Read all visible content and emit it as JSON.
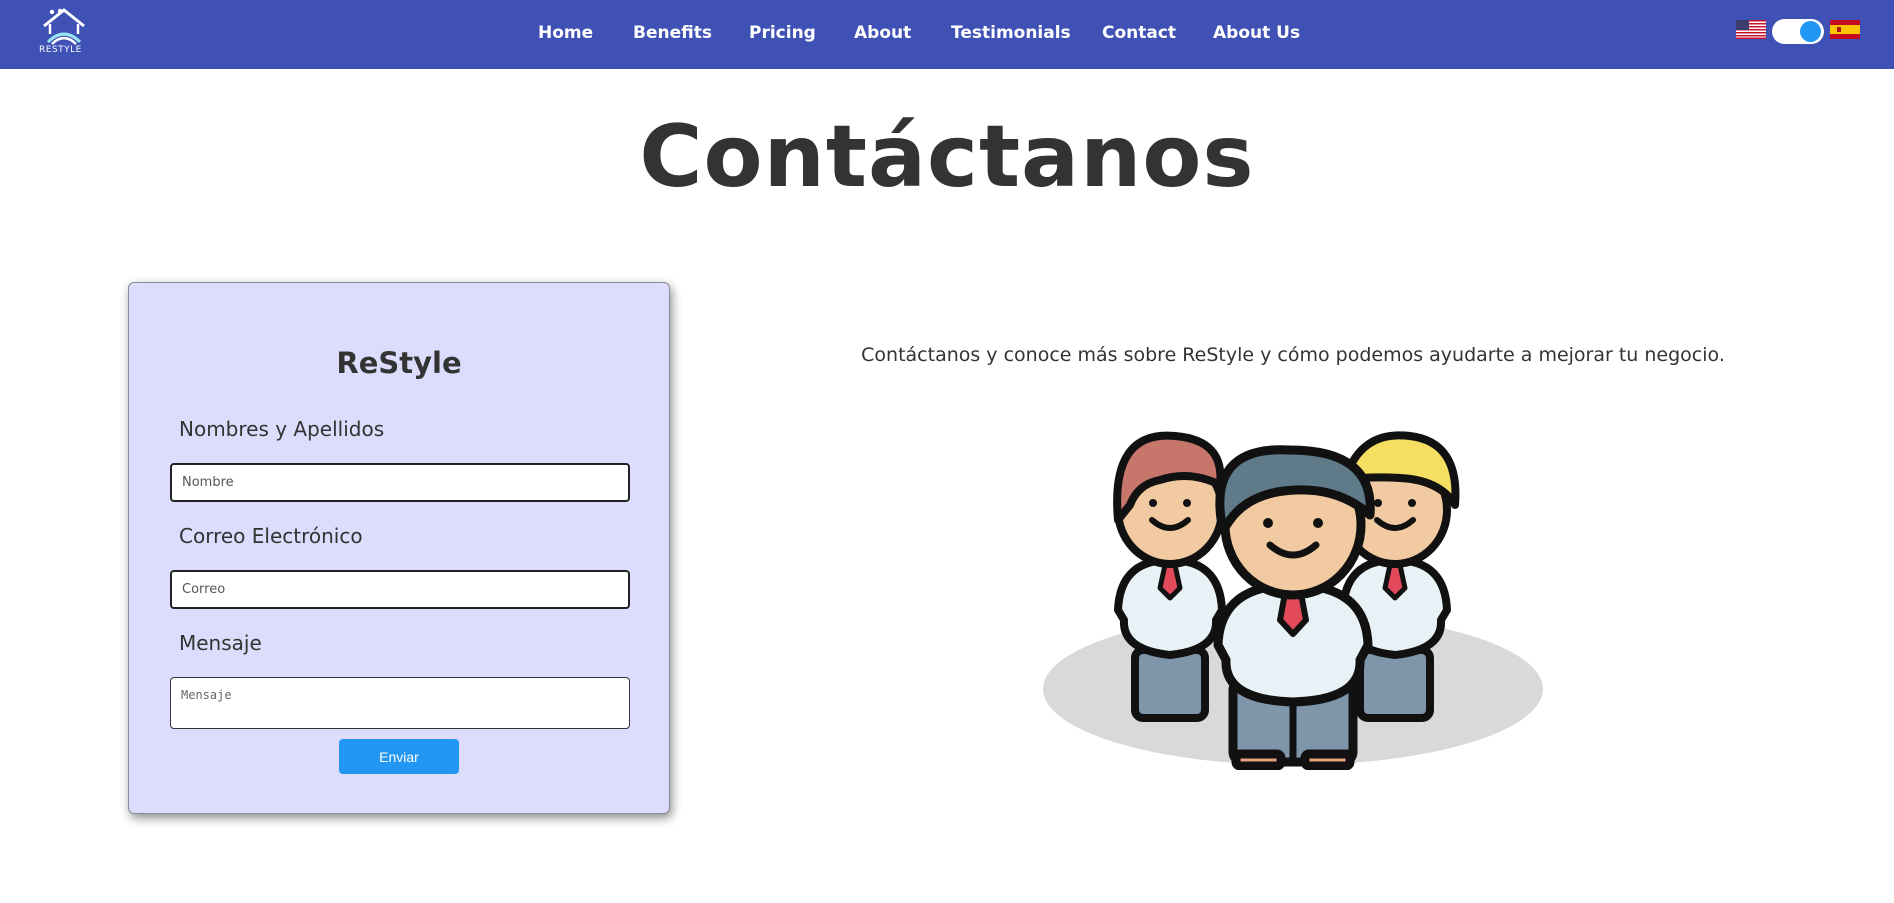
{
  "brand": {
    "logo_text": "RESTYLE"
  },
  "nav": {
    "links": [
      "Home",
      "Benefits",
      "Pricing",
      "About",
      "Testimonials",
      "Contact",
      "About Us"
    ]
  },
  "language": {
    "left_flag": "us-flag-icon",
    "right_flag": "spain-flag-icon",
    "toggle_state": "on"
  },
  "page": {
    "title": "Contáctanos"
  },
  "form": {
    "title": "ReStyle",
    "name_label": "Nombres y Apellidos",
    "name_placeholder": "Nombre",
    "email_label": "Correo Electrónico",
    "email_placeholder": "Correo",
    "message_label": "Mensaje",
    "message_placeholder": "Mensaje",
    "submit_label": "Enviar"
  },
  "info": {
    "tagline": "Contáctanos y conoce más sobre ReStyle y cómo podemos ayudarte a mejorar tu negocio."
  },
  "colors": {
    "navbar": "#3f51b5",
    "card_bg": "#dcdcfc",
    "button": "#2196f3",
    "toggle_knob": "#2196f3"
  }
}
